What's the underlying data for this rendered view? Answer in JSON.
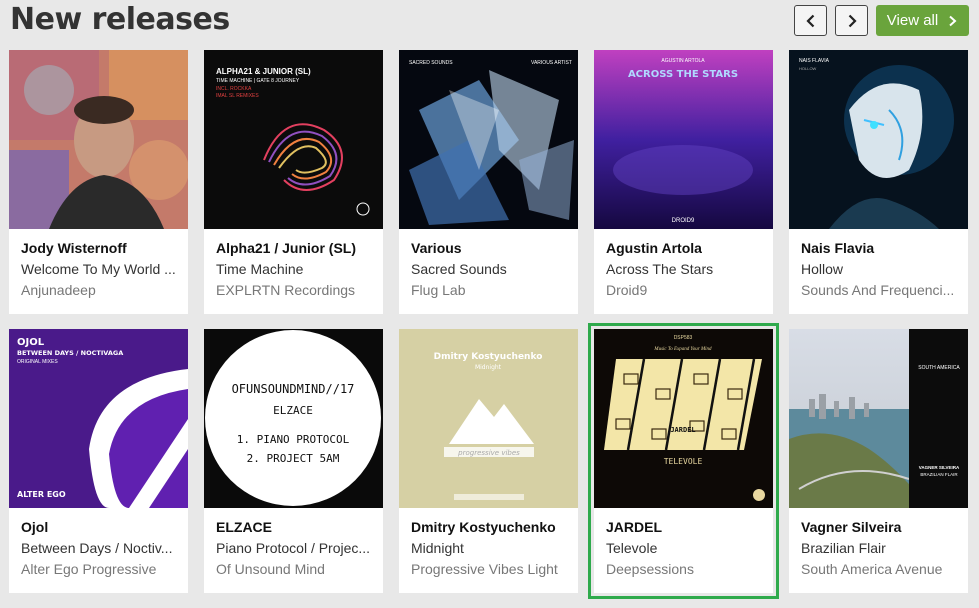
{
  "header": {
    "title": "New releases",
    "view_all_label": "View all",
    "prev_icon": "chevron-left-icon",
    "next_icon": "chevron-right-icon",
    "accent_color": "#6aa43c"
  },
  "selection_color": "#2faa4c",
  "releases": [
    {
      "artist": "Jody Wisternoff",
      "title": "Welcome To My World ...",
      "label": "Anjunadeep",
      "cover_text": []
    },
    {
      "artist": "Alpha21 / Junior (SL)",
      "title": "Time Machine",
      "label": "EXPLRTN Recordings",
      "cover_text": [
        "ALPHA21 & JUNIOR (SL)",
        "TIME MACHINE | GATE 8 JOURNEY",
        "INCL. ROCKKA",
        "IMAL SL REMIXES"
      ]
    },
    {
      "artist": "Various",
      "title": "Sacred Sounds",
      "label": "Flug Lab",
      "cover_text": [
        "SACRED SOUNDS",
        "VARIOUS ARTIST"
      ]
    },
    {
      "artist": "Agustin Artola",
      "title": "Across The Stars",
      "label": "Droid9",
      "cover_text": [
        "AGUSTIN ARTOLA",
        "ACROSS THE STARS",
        "DROID9"
      ]
    },
    {
      "artist": "Nais Flavia",
      "title": "Hollow",
      "label": "Sounds And Frequenci...",
      "cover_text": [
        "NAIS FLAVIA",
        "HOLLOW"
      ]
    },
    {
      "artist": "Ojol",
      "title": "Between Days / Noctiv...",
      "label": "Alter Ego Progressive",
      "cover_text": [
        "OJOL",
        "BETWEEN DAYS / NOCTIVAGA",
        "ORIGINAL MIXES",
        "ALTER EGO"
      ]
    },
    {
      "artist": "ELZACE",
      "title": "Piano Protocol / Projec...",
      "label": "Of Unsound Mind",
      "cover_text": [
        "OFUNSOUNDMIND//17",
        "ELZACE",
        "1. PIANO PROTOCOL",
        "2. PROJECT 5AM"
      ]
    },
    {
      "artist": "Dmitry Kostyuchenko",
      "title": "Midnight",
      "label": "Progressive Vibes Light",
      "cover_text": [
        "Dmitry Kostyuchenko",
        "Midnight",
        "progressive vibes"
      ]
    },
    {
      "artist": "JARDEL",
      "title": "Televole",
      "label": "Deepsessions",
      "cover_text": [
        "DSP583",
        "Music To Expand Your Mind",
        "JARDEL",
        "TELEVOLE"
      ]
    },
    {
      "artist": "Vagner Silveira",
      "title": "Brazilian Flair",
      "label": "South America Avenue",
      "cover_text": [
        "SOUTH AMERICA",
        "VAGNER SILVEIRA",
        "BRAZILIAN FLAIR"
      ]
    }
  ]
}
